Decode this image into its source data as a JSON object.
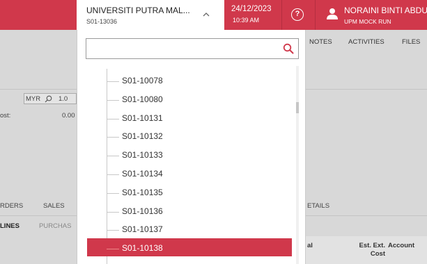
{
  "header": {
    "branch_name": "UNIVERSITI PUTRA MAL...",
    "branch_code": "S01-13036",
    "date": "24/12/2023",
    "time": "10:39 AM",
    "help_glyph": "?",
    "user_name": "NORAINI BINTI ABDU",
    "user_company": "UPM MOCK RUN"
  },
  "background": {
    "top_tabs": [
      "NOTES",
      "ACTIVITIES",
      "FILES"
    ],
    "currency": "MYR",
    "rate_fragment": "1.0",
    "cost_label_fragment": "ost:",
    "cost_value": "0.00",
    "section_tabs": [
      "RDERS",
      "SALES",
      "ETAILS"
    ],
    "sub_tabs": [
      "LINES",
      "PURCHAS"
    ],
    "grid_columns": [
      "al",
      "Est. Ext.\nCost",
      "Account"
    ]
  },
  "dropdown": {
    "search_value": "",
    "items": [
      {
        "label": "S01-10078",
        "selected": false
      },
      {
        "label": "S01-10080",
        "selected": false
      },
      {
        "label": "S01-10131",
        "selected": false
      },
      {
        "label": "S01-10132",
        "selected": false
      },
      {
        "label": "S01-10133",
        "selected": false
      },
      {
        "label": "S01-10134",
        "selected": false
      },
      {
        "label": "S01-10135",
        "selected": false
      },
      {
        "label": "S01-10136",
        "selected": false
      },
      {
        "label": "S01-10137",
        "selected": false
      },
      {
        "label": "S01-10138",
        "selected": true
      }
    ]
  },
  "colors": {
    "accent": "#d0384b"
  }
}
